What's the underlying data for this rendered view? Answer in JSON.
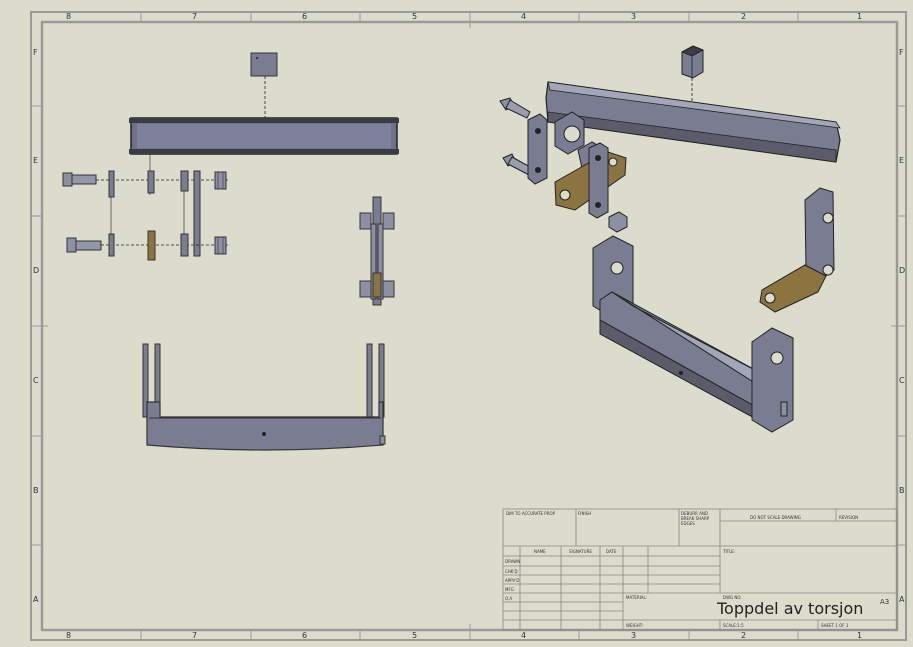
{
  "border": {
    "top_zones": [
      "8",
      "7",
      "6",
      "5",
      "4",
      "3",
      "2",
      "1"
    ],
    "bottom_zones": [
      "8",
      "7",
      "6",
      "5",
      "4",
      "3",
      "2",
      "1"
    ],
    "left_zones": [
      "F",
      "E",
      "D",
      "C",
      "B",
      "A"
    ],
    "right_zones": [
      "F",
      "E",
      "D",
      "C",
      "B",
      "A"
    ]
  },
  "title_block": {
    "unless_note": "DIM TO ACCURATE PROP",
    "finish_label": "FINISH",
    "deburr_note": "DEBURR AND BREAK SHARP EDGES",
    "do_not_scale": "DO NOT SCALE DRAWING",
    "revision_label": "REVISION",
    "col_name": "NAME",
    "col_signature": "SIGNATURE",
    "col_date": "DATE",
    "row_drawn": "DRAWN",
    "row_chkd": "CHK'D",
    "row_appvd": "APPV'D",
    "row_mfg": "MFG",
    "row_qa": "Q.A",
    "title_label": "TITLE:",
    "material_label": "MATERIAL:",
    "weight_label": "WEIGHT:",
    "dwg_no_label": "DWG NO.",
    "scale_label": "SCALE:1:5",
    "sheet_label": "SHEET 1 OF 1",
    "drawing_title": "Toppdel av torsjon",
    "sheet_size": "A3"
  },
  "colors": {
    "paper": "#dcdccc",
    "border_line": "#9a9a9a",
    "part_steel": "#7a7d92",
    "part_dark": "#4a4c58",
    "part_bronze": "#8c7440"
  }
}
